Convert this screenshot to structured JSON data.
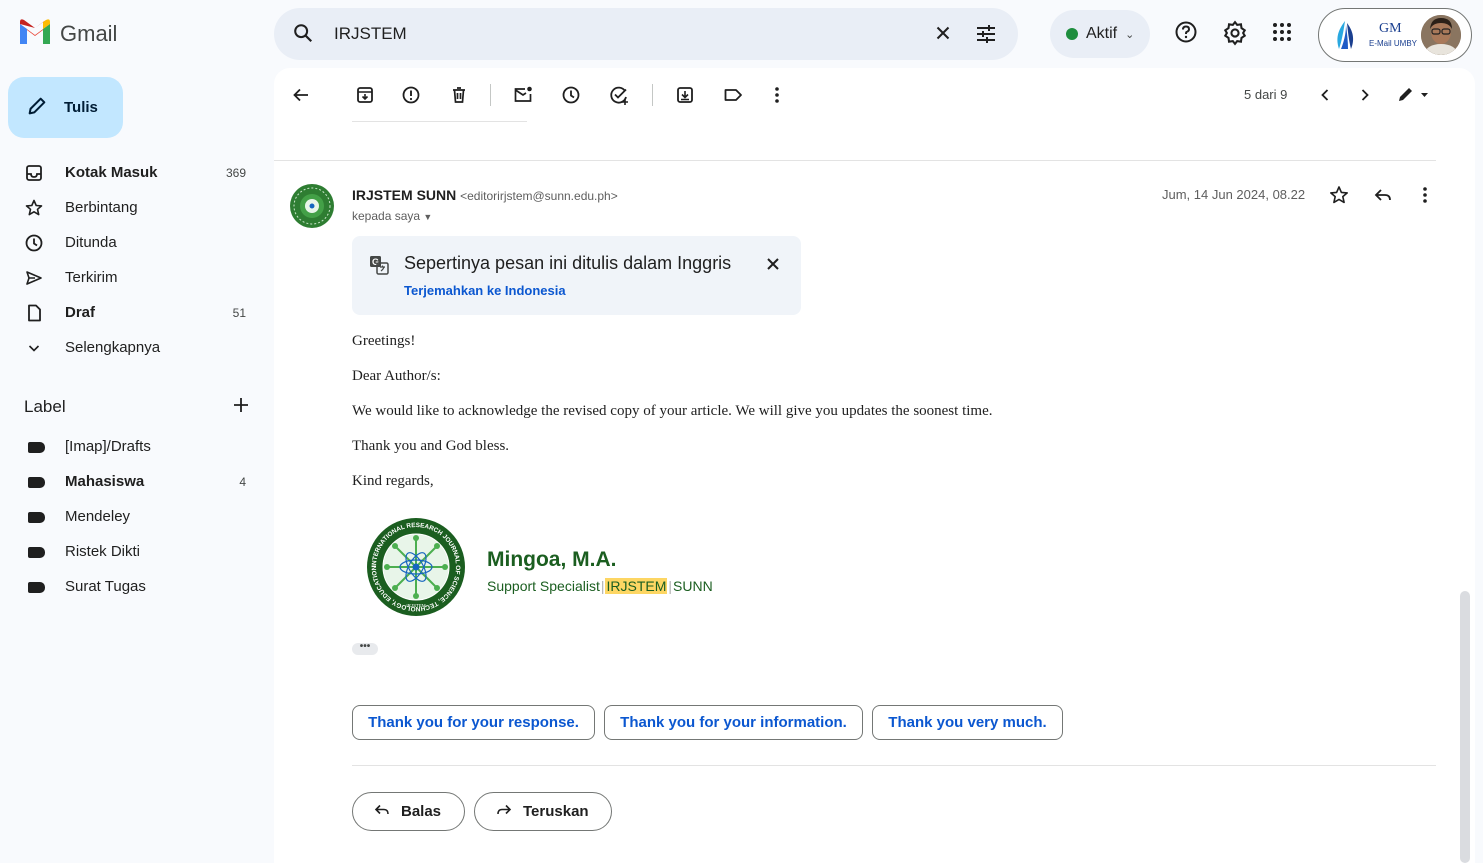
{
  "app": {
    "name": "Gmail"
  },
  "search": {
    "query": "IRJSTEM"
  },
  "status": {
    "label": "Aktif"
  },
  "account": {
    "org_logo_text": "GM",
    "org_name": "E-Mail UMBY"
  },
  "compose": {
    "label": "Tulis"
  },
  "nav": [
    {
      "label": "Kotak Masuk",
      "count": "369",
      "bold": true
    },
    {
      "label": "Berbintang",
      "count": ""
    },
    {
      "label": "Ditunda",
      "count": ""
    },
    {
      "label": "Terkirim",
      "count": ""
    },
    {
      "label": "Draf",
      "count": "51",
      "bold": true
    },
    {
      "label": "Selengkapnya",
      "count": ""
    }
  ],
  "labels": {
    "header": "Label",
    "items": [
      {
        "label": "[Imap]/Drafts",
        "count": ""
      },
      {
        "label": "Mahasiswa",
        "count": "4",
        "bold": true
      },
      {
        "label": "Mendeley",
        "count": ""
      },
      {
        "label": "Ristek Dikti",
        "count": ""
      },
      {
        "label": "Surat Tugas",
        "count": ""
      }
    ]
  },
  "toolbar": {
    "pager": "5 dari 9"
  },
  "message": {
    "sender_name": "IRJSTEM SUNN",
    "sender_email": "<editorirjstem@sunn.edu.ph>",
    "to": "kepada saya",
    "date": "Jum, 14 Jun 2024, 08.22",
    "translate_banner": "Sepertinya pesan ini ditulis dalam Inggris",
    "translate_link": "Terjemahkan ke Indonesia",
    "body": [
      "Greetings!",
      "Dear Author/s:",
      "We would like to acknowledge the revised copy of your article. We will give you updates the soonest time.",
      "Thank you and God bless.",
      "Kind regards,"
    ],
    "signature": {
      "name": "Mingoa, M.A.",
      "role": "Support Specialist",
      "highlight": "IRJSTEM",
      "org": "SUNN",
      "logo_ring_text": "INTERNATIONAL RESEARCH JOURNAL OF SCIENCE, TECHNOLOGY, EDUCATION, AND MANAGEMENT",
      "logo_short": "·IRJSTEM·"
    },
    "more": "•••"
  },
  "smart_replies": [
    "Thank you for your response.",
    "Thank you for your information.",
    "Thank you very much."
  ],
  "actions": {
    "reply": "Balas",
    "forward": "Teruskan"
  },
  "colors": {
    "compose_bg": "#c2e7ff",
    "accent_blue": "#0b57d0",
    "sig_green": "#1b5e20",
    "highlight": "#fdd663"
  }
}
